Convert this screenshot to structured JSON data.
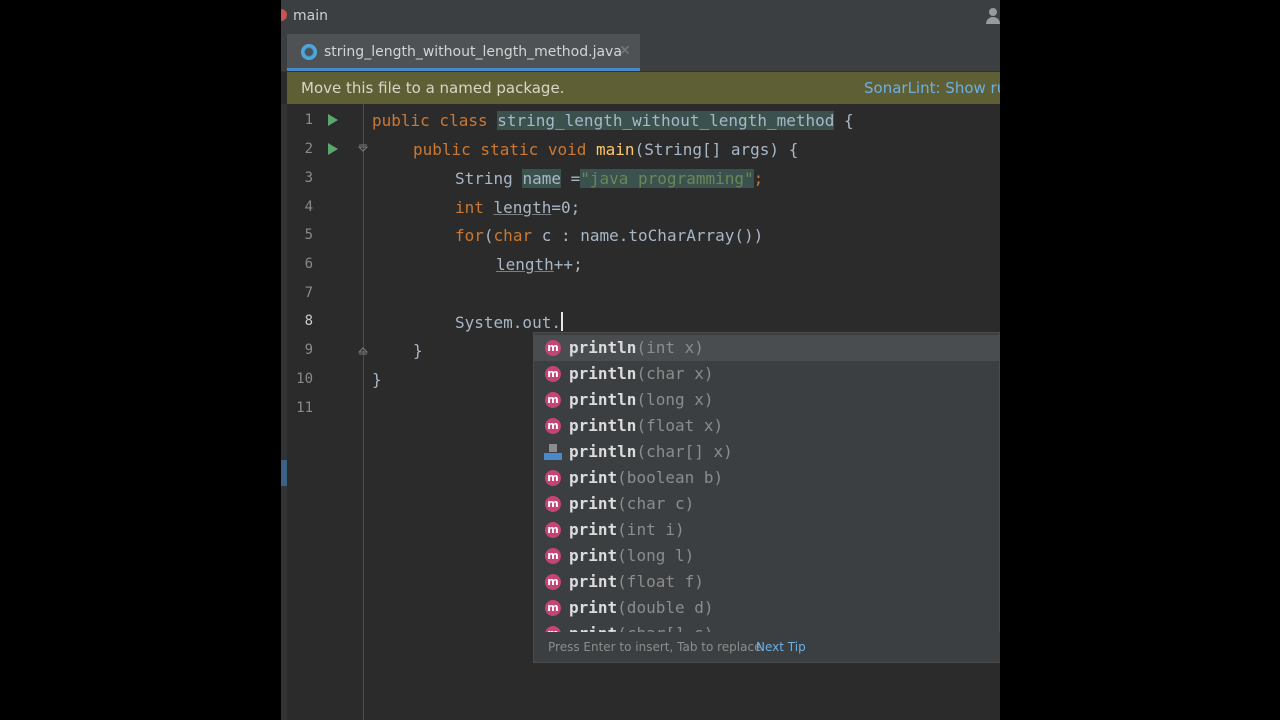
{
  "titlebar": {
    "branch": "main"
  },
  "tab": {
    "label": "string_length_without_length_method.java",
    "close": "✕"
  },
  "banner": {
    "message": "Move this file to a named package.",
    "link": "SonarLint: Show rule"
  },
  "editor": {
    "lines": [
      "1",
      "2",
      "3",
      "4",
      "5",
      "6",
      "7",
      "8",
      "9",
      "10",
      "11"
    ],
    "code": {
      "l1": {
        "kw": "public class ",
        "cls": "string_length_without_length_method",
        "rest": " {"
      },
      "l2": {
        "kw": "public static void ",
        "fn": "main",
        "rest": "(String[] args) {"
      },
      "l3": {
        "type": "String ",
        "var": "name",
        "eq": " =",
        "str": "\"java programming\"",
        "semi": ";"
      },
      "l4": {
        "kw": "int ",
        "var": "length",
        "rest": "=0;"
      },
      "l5": {
        "kw1": "for",
        "p1": "(",
        "kw2": "char",
        "rest": " c : name.toCharArray())"
      },
      "l6": {
        "var": "length",
        "rest": "++;"
      },
      "l8": {
        "text": "System.out."
      },
      "l9": {
        "text": "}"
      },
      "l10": {
        "text": "}"
      }
    }
  },
  "completion": {
    "items": [
      {
        "icon": "m",
        "name": "println",
        "sig": "(int x)"
      },
      {
        "icon": "m",
        "name": "println",
        "sig": "(char x)"
      },
      {
        "icon": "m",
        "name": "println",
        "sig": "(long x)"
      },
      {
        "icon": "m",
        "name": "println",
        "sig": "(float x)"
      },
      {
        "icon": "alt",
        "name": "println",
        "sig": "(char[] x)"
      },
      {
        "icon": "m",
        "name": "print",
        "sig": "(boolean b)"
      },
      {
        "icon": "m",
        "name": "print",
        "sig": "(char c)"
      },
      {
        "icon": "m",
        "name": "print",
        "sig": "(int i)"
      },
      {
        "icon": "m",
        "name": "print",
        "sig": "(long l)"
      },
      {
        "icon": "m",
        "name": "print",
        "sig": "(float f)"
      },
      {
        "icon": "m",
        "name": "print",
        "sig": "(double d)"
      },
      {
        "icon": "m",
        "name": "print",
        "sig": "(char[] s)"
      }
    ],
    "footer_hint": "Press Enter to insert, Tab to replace",
    "footer_link": "Next Tip"
  },
  "colors": {
    "accent": "#4a88c7",
    "method_icon": "#c54474",
    "banner": "#5f5f36",
    "editor_bg": "#2b2b2b"
  }
}
